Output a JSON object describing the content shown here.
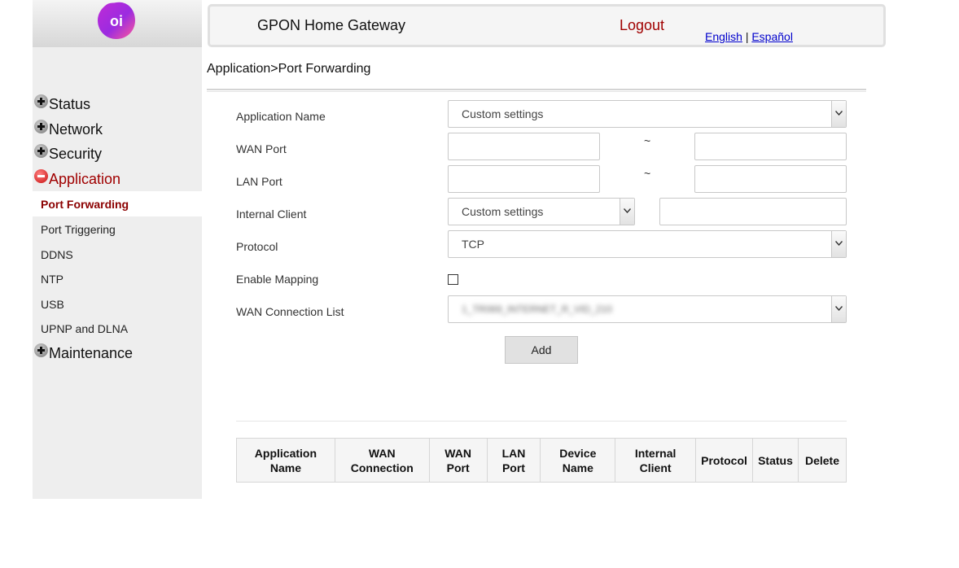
{
  "brand": {
    "logo_text": "oi"
  },
  "header": {
    "title": "GPON Home Gateway",
    "logout": "Logout",
    "lang_english": "English",
    "lang_separator": "|",
    "lang_spanish": "Español"
  },
  "breadcrumb": "Application>Port Forwarding",
  "sidebar": {
    "status": "Status",
    "network": "Network",
    "security": "Security",
    "application": "Application",
    "sub": {
      "port_forwarding": "Port Forwarding",
      "port_triggering": "Port Triggering",
      "ddns": "DDNS",
      "ntp": "NTP",
      "usb": "USB",
      "upnp": "UPNP and DLNA"
    },
    "maintenance": "Maintenance"
  },
  "form": {
    "app_name_label": "Application Name",
    "app_name_value": "Custom settings",
    "wan_port_label": "WAN Port",
    "lan_port_label": "LAN Port",
    "range_sep": "~",
    "internal_client_label": "Internal Client",
    "internal_client_value": "Custom settings",
    "protocol_label": "Protocol",
    "protocol_value": "TCP",
    "enable_mapping_label": "Enable Mapping",
    "wan_conn_list_label": "WAN Connection List",
    "wan_conn_list_value": "1_TR069_INTERNET_R_VID_210",
    "add_button": "Add"
  },
  "table": {
    "headers": {
      "app_name": "Application Name",
      "wan_connection": "WAN Connection",
      "wan_port": "WAN Port",
      "lan_port": "LAN Port",
      "device_name": "Device Name",
      "internal_client": "Internal Client",
      "protocol": "Protocol",
      "status": "Status",
      "delete": "Delete"
    }
  },
  "colors": {
    "accent": "#a00000",
    "link": "#0000cc",
    "sidebar_bg": "#eeeeee"
  }
}
